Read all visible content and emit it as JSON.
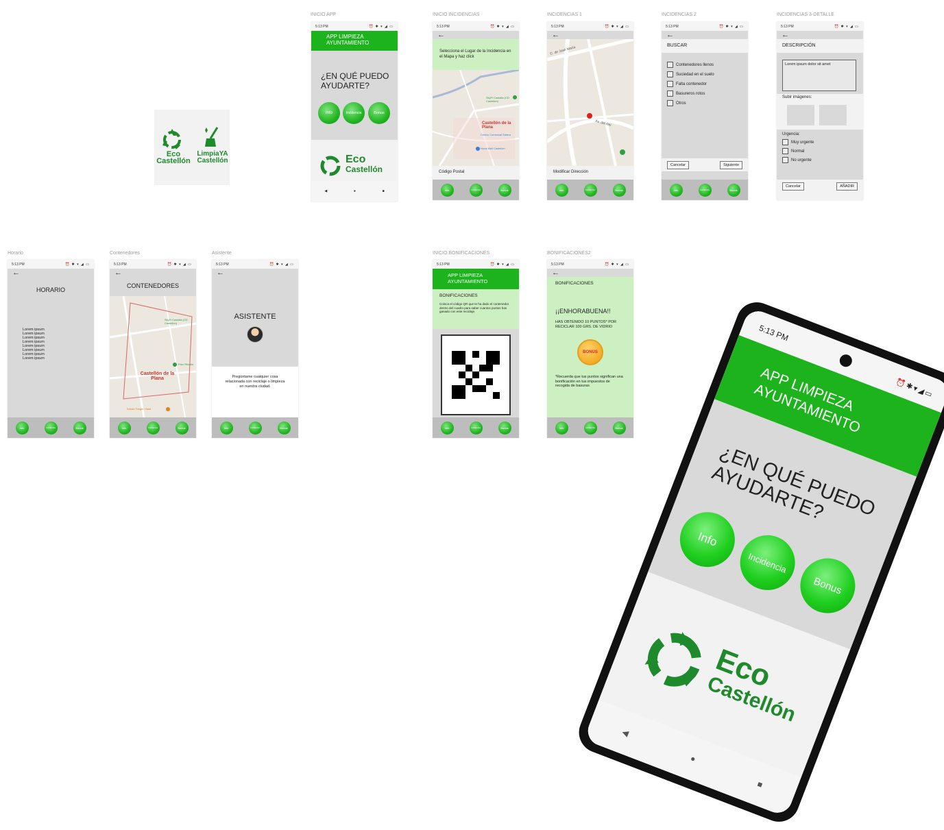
{
  "logo_card": {
    "eco_line1": "Eco",
    "eco_line2": "Castellón",
    "limpia_line1": "LimpiaYA",
    "limpia_line2": "Castellón"
  },
  "status": {
    "time": "5:13 PM",
    "icons": "⏰ ✱ ▾ ◢ ▭"
  },
  "nav_buttons": {
    "info": "Info",
    "incidencia": "Incidencia",
    "bonus": "Bonus"
  },
  "frames": {
    "inicio": {
      "label": "INICIO APP",
      "header": "APP LIMPIEZA AYUNTAMIENTO",
      "question": "¿EN QUÉ PUEDO AYUDARTE?",
      "eco": "Eco",
      "castellon": "Castellón"
    },
    "incidencias": {
      "label": "INICIO INCIDENCIAS",
      "instruction": "Selecciona el Lugar de la Incidencia en el Mapa y haz click",
      "city_label": "Castellón de la Plana",
      "poi1": "SkyFi Castalia (CD Castellón)",
      "poi2": "Centro Comercial Salera",
      "poi3": "Nova Moll Castellón",
      "footer": "Código Postal"
    },
    "incidencias1": {
      "label": "INCIDENCIAS 1",
      "street1": "C. de José María",
      "street2": "Av. del Rei",
      "footer": "Modificar Dirección"
    },
    "incidencias2": {
      "label": "INCIDENCIAS 2",
      "title": "BUSCAR",
      "options": [
        "Contenedores llenos",
        "Suciedad en el suelo",
        "Falta contenedor",
        "Basureros rotos",
        "Otros"
      ],
      "cancel": "Cancelar",
      "next": "Siguiente"
    },
    "incidencias3": {
      "label": "INCIDENCIAS 3-DETALLE",
      "title": "DESCRIPCIÓN",
      "textarea": "Lorem ipsum dolor sit amet",
      "upload": "Subir imágenes:",
      "urgency": "Urgencia:",
      "levels": [
        "Muy urgente",
        "Normal",
        "No urgente"
      ],
      "cancel": "Cancelar",
      "add": "AÑADIR"
    },
    "horario": {
      "label": "Horario",
      "title": "HORARIO",
      "lines": [
        "Lorem ipsum",
        "Lorem ipsum",
        "Lorem ipsum",
        "Lorem ipsum",
        "Lorem ipsum",
        "Lorem ipsum",
        "Lorem ipsum",
        "Lorem ipsum"
      ]
    },
    "contenedores": {
      "label": "Contenedores",
      "title": "CONTENEDORES",
      "city": "Castellón de la Plana",
      "poi1": "SkyFi Castalia (CD Castellón)",
      "poi2": "Parc Ribalta",
      "poi3": "Kebab Tanger Halal"
    },
    "asistente": {
      "label": "Asistente",
      "title": "ASISTENTE",
      "bubble": "Pregúntame cualquier cosa relacionada con reciclaje o limpieza en nuestra ciudad."
    },
    "bonificaciones": {
      "label": "INICIO BONIFICACIONES",
      "header": "APP LIMPIEZA AYUNTAMIENTO",
      "title": "BONIFICACIONES",
      "text": "Coloca el código QR que te ha dado el contenedor dentro del cuadro para saber cuantos puntos has ganado con este reciclaje."
    },
    "bonificaciones2": {
      "label": "BONIFICACIONES2",
      "title": "BONIFICACIONES",
      "congrats": "¡¡ENHORABUENA!!",
      "points": "HAS OBTENIDO 10 PUNTOS* POR RECICLAR 100 GRS. DE VIDRIO",
      "badge": "BONUS",
      "note": "*Recuerda que tus puntos significan una bonificación en tus impuestos de recogida de basuras"
    }
  },
  "mockup": {
    "time": "5:13 PM",
    "header": "APP LIMPIEZA AYUNTAMIENTO",
    "question": "¿EN QUÉ PUEDO AYUDARTE?",
    "info": "Info",
    "incidencia": "Incidencia",
    "bonus": "Bonus",
    "eco": "Eco",
    "castellon": "Castellón"
  },
  "colors": {
    "brand_green": "#1db31d",
    "dark_green": "#1f8a2c",
    "light_green": "#cdf0c3",
    "screen_gray": "#d9d9d9"
  }
}
